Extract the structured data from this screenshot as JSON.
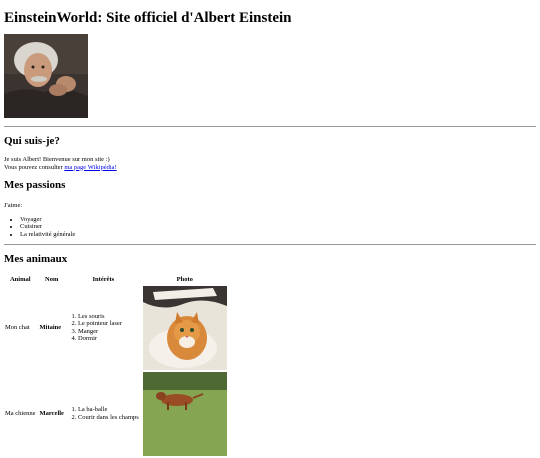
{
  "header": {
    "title": "EinsteinWorld: Site officiel d'Albert Einstein"
  },
  "portrait": {
    "alt": "Albert Einstein"
  },
  "about": {
    "heading": "Qui suis-je?",
    "line1": "Je suis Albert! Bienvenue sur mon site :)",
    "line2_prefix": "Vous pouvez consulter ",
    "link_text": "ma page Wikipédia!"
  },
  "passions": {
    "heading": "Mes passions",
    "intro": "J'aime:",
    "items": [
      "Voyager",
      "Cuisiner",
      "La relativité générale"
    ]
  },
  "pets": {
    "heading": "Mes animaux",
    "columns": [
      "Animal",
      "Nom",
      "Intérêts",
      "Photo"
    ],
    "rows": [
      {
        "animal": "Mon chat",
        "name": "Mitaine",
        "interests": [
          "Les souris",
          "Le pointeur laser",
          "Manger",
          "Dormir"
        ]
      },
      {
        "animal": "Ma chienne",
        "name": "Marcelle",
        "interests": [
          "La ba-balle",
          "Courir dans les champs"
        ]
      }
    ]
  }
}
